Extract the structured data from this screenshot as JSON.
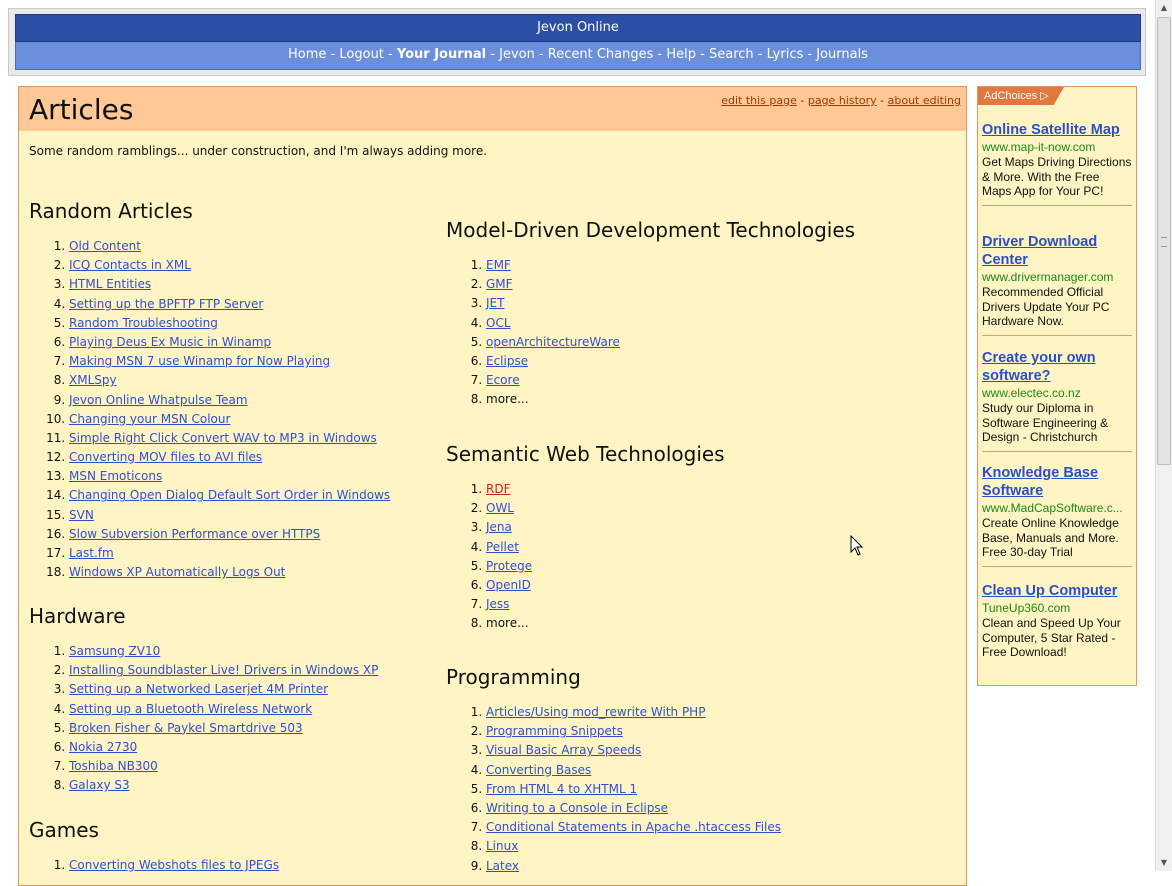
{
  "header": {
    "site_title": "Jevon Online",
    "nav": [
      {
        "label": "Home",
        "current": false
      },
      {
        "label": "Logout",
        "current": false
      },
      {
        "label": "Your Journal",
        "current": true
      },
      {
        "label": "Jevon",
        "current": false
      },
      {
        "label": "Recent Changes",
        "current": false
      },
      {
        "label": "Help",
        "current": false
      },
      {
        "label": "Search",
        "current": false
      },
      {
        "label": "Lyrics",
        "current": false
      },
      {
        "label": "Journals",
        "current": false
      }
    ],
    "separator": " - "
  },
  "page": {
    "title": "Articles",
    "actions": {
      "edit": "edit this page",
      "history": "page history",
      "about": "about editing",
      "separator": " - "
    },
    "intro": "Some random ramblings... under construction, and I'm always adding more."
  },
  "sections": {
    "random": {
      "heading": "Random Articles",
      "items": [
        "Old Content",
        "ICQ Contacts in XML",
        "HTML Entities",
        "Setting up the BPFTP FTP Server",
        "Random Troubleshooting",
        "Playing Deus Ex Music in Winamp",
        "Making MSN 7 use Winamp for Now Playing",
        "XMLSpy",
        "Jevon Online Whatpulse Team",
        "Changing your MSN Colour",
        "Simple Right Click Convert WAV to MP3 in Windows",
        "Converting MOV files to AVI files",
        "MSN Emoticons",
        "Changing Open Dialog Default Sort Order in Windows",
        "SVN",
        "Slow Subversion Performance over HTTPS",
        "Last.fm",
        "Windows XP Automatically Logs Out"
      ]
    },
    "hardware": {
      "heading": "Hardware",
      "items": [
        "Samsung ZV10",
        "Installing Soundblaster Live! Drivers in Windows XP",
        "Setting up a Networked Laserjet 4M Printer",
        "Setting up a Bluetooth Wireless Network",
        "Broken Fisher & Paykel Smartdrive 503",
        "Nokia 2730",
        "Toshiba NB300",
        "Galaxy S3"
      ]
    },
    "games": {
      "heading": "Games",
      "items": [
        "Converting Webshots files to JPEGs"
      ]
    },
    "mdd": {
      "heading": "Model-Driven Development Technologies",
      "items": [
        "EMF",
        "GMF",
        "JET",
        "OCL",
        "openArchitectureWare",
        "Eclipse",
        "Ecore"
      ],
      "more": "more..."
    },
    "semantic": {
      "heading": "Semantic Web Technologies",
      "items": [
        "RDF",
        "OWL",
        "Jena",
        "Pellet",
        "Protege",
        "OpenID",
        "Jess"
      ],
      "redlinks": [
        "RDF"
      ],
      "more": "more..."
    },
    "programming": {
      "heading": "Programming",
      "items": [
        "Articles/Using mod_rewrite With PHP",
        "Programming Snippets",
        "Visual Basic Array Speeds",
        "Converting Bases",
        "From HTML 4 to XHTML 1",
        "Writing to a Console in Eclipse",
        "Conditional Statements in Apache .htaccess Files",
        "Linux",
        "Latex"
      ]
    }
  },
  "ads": {
    "adchoices_label": "AdChoices",
    "items": [
      {
        "title": "Online Satellite Map",
        "url": "www.map-it-now.com",
        "desc": "Get Maps Driving Directions & More. With the Free Maps App for Your PC!"
      },
      {
        "title": "Driver Download Center",
        "url": "www.drivermanager.com",
        "desc": "Recommended Official Drivers Update Your PC Hardware Now."
      },
      {
        "title": "Create your own software?",
        "url": "www.electec.co.nz",
        "desc": "Study our Diploma in Software Engineering & Design - Christchurch"
      },
      {
        "title": "Knowledge Base Software",
        "url": "www.MadCapSoftware.c...",
        "desc": "Create Online Knowledge Base, Manuals and More. Free 30-day Trial"
      },
      {
        "title": "Clean Up Computer",
        "url": "TuneUp360.com",
        "desc": "Clean and Speed Up Your Computer, 5 Star Rated - Free Download!"
      }
    ]
  },
  "colors": {
    "title_bar": "#2c4fa6",
    "nav_bar": "#6c8fdc",
    "content_bg": "#fff5c4",
    "article_header_bg": "#ffc896",
    "link": "#2f4fd1",
    "redlink": "#cc1f1f",
    "ad_url": "#1a8a1a"
  },
  "icons": {
    "adchoices": "adchoices-triangle-icon",
    "cursor": "mouse-pointer-icon"
  }
}
